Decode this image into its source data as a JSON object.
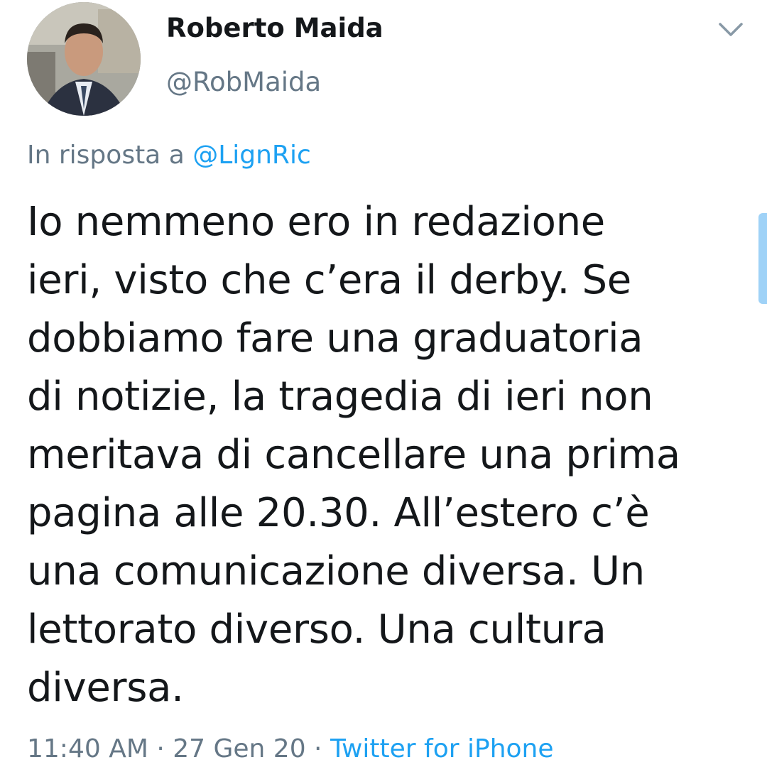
{
  "author": {
    "name": "Roberto Maida",
    "handle": "@RobMaida",
    "avatar_icon": "profile-photo"
  },
  "menu_icon": "chevron-down-icon",
  "reply": {
    "prefix": "In risposta a ",
    "mention": "@LignRic"
  },
  "tweet": {
    "text": "Io nemmeno ero in redazione\nieri, visto che c’era il derby. Se\ndobbiamo fare una graduatoria\ndi notizie, la tragedia di ieri non\nmeritava di cancellare una prima\npagina alle 20.30. All’estero c’è\nuna comunicazione diversa. Un\nlettorato diverso. Una cultura\ndiversa."
  },
  "meta": {
    "time": "11:40 AM",
    "separator": " · ",
    "date": "27 Gen 20",
    "source": "Twitter for iPhone"
  },
  "colors": {
    "accent": "#1da1f2",
    "secondary_text": "#657786",
    "primary_text": "#14171a"
  }
}
